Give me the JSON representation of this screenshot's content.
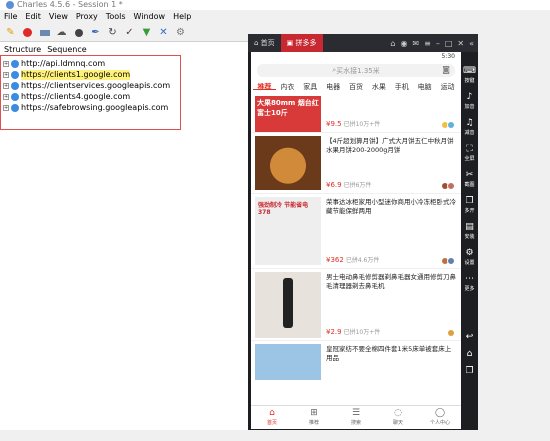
{
  "window": {
    "title": "Charles 4.5.6 - Session 1 *"
  },
  "menu": [
    "File",
    "Edit",
    "View",
    "Proxy",
    "Tools",
    "Window",
    "Help"
  ],
  "toolbar": {
    "icons": [
      "broom-icon",
      "record-icon",
      "throttle-icon",
      "cloud-icon",
      "stop-icon",
      "pen-icon",
      "refresh-icon",
      "check-icon",
      "basket-icon",
      "tools-icon",
      "gear-icon"
    ]
  },
  "tabs": {
    "structure": "Structure",
    "sequence": "Sequence"
  },
  "hosts": [
    {
      "label": "http://api.ldmnq.com",
      "highlight": false
    },
    {
      "label": "https://clients1.google.com",
      "highlight": true
    },
    {
      "label": "https://clientservices.googleapis.com",
      "highlight": false
    },
    {
      "label": "https://clients4.google.com",
      "highlight": false
    },
    {
      "label": "https://safebrowsing.googleapis.com",
      "highlight": false
    }
  ],
  "emulator": {
    "tabs": [
      "首页",
      "拼多多"
    ],
    "status": {
      "left": "",
      "right": "5:30"
    },
    "search_placeholder": "买水接1.35米",
    "categories": [
      "推荐",
      "内衣",
      "家具",
      "电器",
      "百货",
      "水果",
      "手机",
      "电脑",
      "运动"
    ],
    "products": [
      {
        "title": "",
        "price": "¥9.5",
        "sold": "已拼10万+件",
        "img_color": "#d83a3a",
        "img_text": "大果80mm 烟台红富士10斤"
      },
      {
        "title": "【4斤超划算月饼】广式大月饼五仁中秋月饼水果月饼200-2000g月饼",
        "price": "¥6.9",
        "sold": "已拼6万件",
        "img_color": "#b5651d",
        "img_text": ""
      },
      {
        "title": "荣事达冰柜家用小型迷你商用小冷冻柜卧式冷藏节能保鲜两用",
        "price": "¥362",
        "sold": "已拼4.6万件",
        "img_color": "#e8e8e8",
        "img_text": "强劲制冷 节能省电 378"
      },
      {
        "title": "男士电动鼻毛修剪器剃鼻毛器女通用修剪刀鼻毛清理器剃去鼻毛机",
        "price": "¥2.9",
        "sold": "已拼10万+件",
        "img_color": "#e7e2dc",
        "img_text": ""
      },
      {
        "title": "皇冠家纺不要全棉四件套1米5床单被套床上用品",
        "price": "",
        "sold": "",
        "img_color": "#9cc4e4",
        "img_text": ""
      }
    ],
    "bottomnav": [
      "首页",
      "推荐",
      "搜索",
      "聊天",
      "个人中心"
    ],
    "sidebar": [
      "按键",
      "加音",
      "减音",
      "全屏",
      "截图",
      "多开",
      "安装",
      "设置",
      "更多"
    ]
  }
}
